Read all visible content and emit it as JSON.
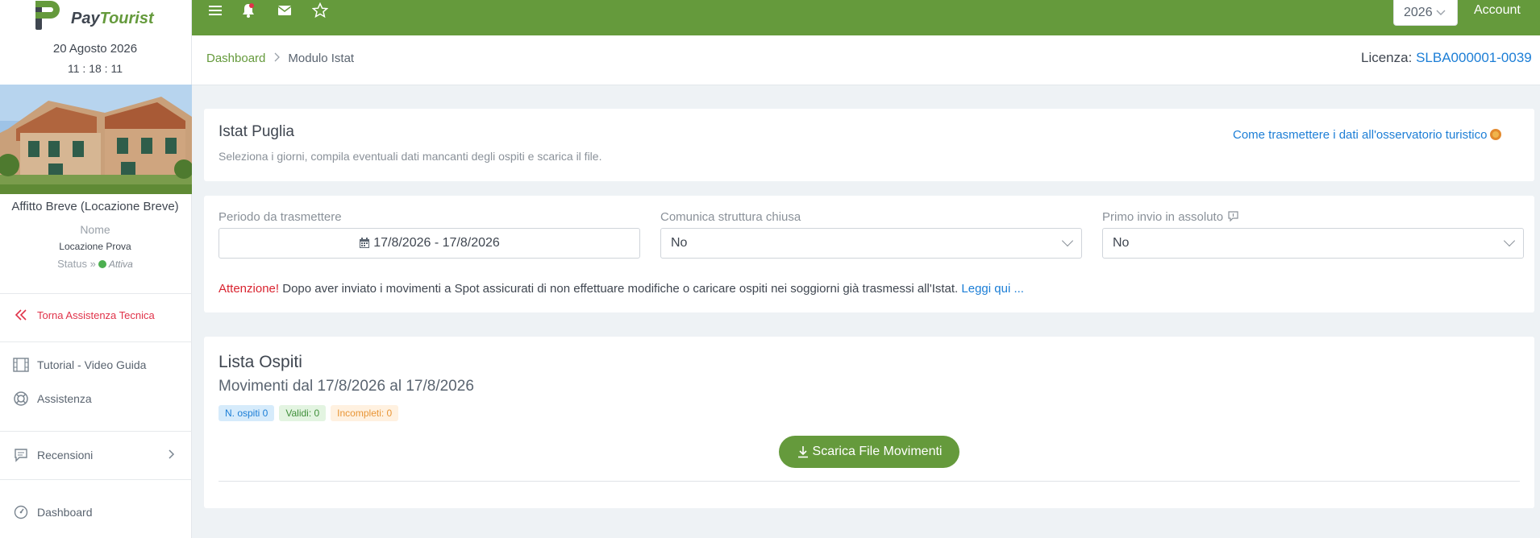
{
  "sidebar": {
    "logo": {
      "pay": "Pay",
      "tourist": "Tourist"
    },
    "date": "20 Agosto 2026",
    "time": "11 : 18 : 11",
    "property_type": "Affitto Breve (Locazione Breve)",
    "name_label": "Nome",
    "name_value": "Locazione Prova",
    "status_label": "Status »",
    "status_value": "Attiva",
    "status_color": "#4caf50",
    "items": {
      "torna": "Torna Assistenza Tecnica",
      "tutorial": "Tutorial - Video Guida",
      "assistenza": "Assistenza",
      "recensioni": "Recensioni",
      "dashboard": "Dashboard"
    }
  },
  "topbar": {
    "brand_color": "#659a3c",
    "icons": [
      "menu-icon",
      "bell-icon",
      "mail-icon",
      "star-icon"
    ],
    "year": "2026",
    "account": "Account"
  },
  "header": {
    "breadcrumb": {
      "home": "Dashboard",
      "current": "Modulo Istat"
    },
    "licenza_label": "Licenza:",
    "licenza_code": "SLBA000001-0039"
  },
  "istat": {
    "title": "Istat Puglia",
    "subtitle": "Seleziona i giorni, compila eventuali dati mancanti degli ospiti e scarica il file.",
    "help_link": "Come trasmettere i dati all'osservatorio turistico"
  },
  "form": {
    "periodo_label": "Periodo da trasmettere",
    "periodo_value": "17/8/2026 - 17/8/2026",
    "chiusa_label": "Comunica struttura chiusa",
    "chiusa_value": "No",
    "primo_label": "Primo invio in assoluto",
    "primo_value": "No",
    "warning_prefix": "Attenzione!",
    "warning_text": " Dopo aver inviato i movimenti a Spot assicurati di non effettuare modifiche o caricare ospiti nei soggiorni già trasmessi all'Istat. ",
    "warning_link": "Leggi qui ..."
  },
  "lista": {
    "title": "Lista Ospiti",
    "subtitle": "Movimenti dal 17/8/2026 al 17/8/2026",
    "badges": {
      "ospiti": "N. ospiti 0",
      "validi": "Validi: 0",
      "incompleti": "Incompleti: 0"
    },
    "download_button": "Scarica File Movimenti"
  }
}
